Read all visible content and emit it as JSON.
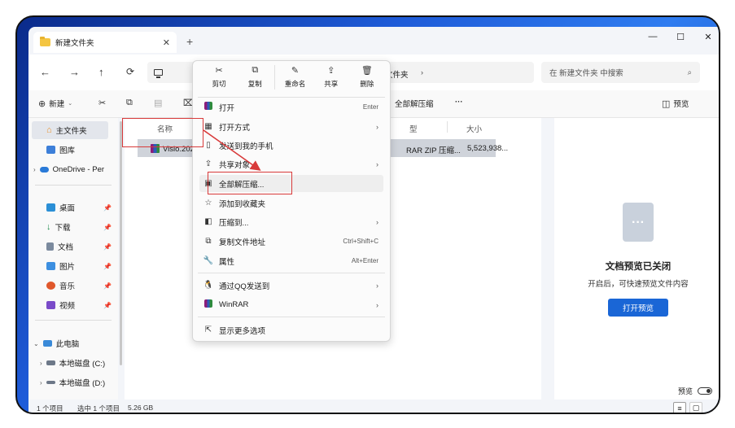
{
  "tab": {
    "title": "新建文件夹",
    "close": "✕",
    "new_tab": "+"
  },
  "window_controls": {
    "minimize": "—",
    "maximize": "☐",
    "close": "✕"
  },
  "nav": {
    "back": "←",
    "forward": "→",
    "up": "↑",
    "refresh": "⟳"
  },
  "address": {
    "current_folder": "文件夹",
    "chevron": "›"
  },
  "search": {
    "placeholder": "在 新建文件夹 中搜索",
    "icon": "⌕"
  },
  "toolbar": {
    "new_label": "新建",
    "extract_all_label": "全部解压缩",
    "more": "···",
    "preview_label": "预览"
  },
  "sidebar": {
    "home": "主文件夹",
    "gallery": "图库",
    "onedrive": "OneDrive - Per",
    "desktop": "桌面",
    "downloads": "下载",
    "documents": "文档",
    "pictures": "图片",
    "music": "音乐",
    "videos": "视频",
    "this_pc": "此电脑",
    "disk_c": "本地磁盘 (C:)",
    "disk_d": "本地磁盘 (D:)"
  },
  "columns": {
    "name": "名称",
    "type": "型",
    "size": "大小"
  },
  "file": {
    "name": "Visio.2024.zip",
    "type": "RAR ZIP 压缩...",
    "size": "5,523,938..."
  },
  "preview": {
    "title": "文档预览已关闭",
    "description": "开启后，可快速预览文件内容",
    "button": "打开预览",
    "toggle_label": "预览"
  },
  "status": {
    "count": "1 个项目",
    "selected": "选中 1 个项目",
    "size": "5.26 GB"
  },
  "context_menu": {
    "actions": [
      {
        "icon": "✂",
        "label": "剪切"
      },
      {
        "icon": "⧉",
        "label": "复制"
      },
      {
        "icon": "✎",
        "label": "重命名"
      },
      {
        "icon": "⇪",
        "label": "共享"
      },
      {
        "icon": "🗑",
        "label": "删除"
      }
    ],
    "items": {
      "open": {
        "label": "打开",
        "shortcut": "Enter"
      },
      "open_with": {
        "label": "打开方式",
        "arrow": "›"
      },
      "send_phone": {
        "label": "发送到我的手机"
      },
      "share": {
        "label": "共享对象",
        "arrow": "›"
      },
      "extract_all": {
        "label": "全部解压缩..."
      },
      "favorites": {
        "label": "添加到收藏夹"
      },
      "compress": {
        "label": "压缩到...",
        "arrow": "›"
      },
      "copy_path": {
        "label": "复制文件地址",
        "shortcut": "Ctrl+Shift+C"
      },
      "properties": {
        "label": "属性",
        "shortcut": "Alt+Enter"
      },
      "send_qq": {
        "label": "通过QQ发送到",
        "arrow": "›"
      },
      "winrar": {
        "label": "WinRAR",
        "arrow": "›"
      },
      "more_options": {
        "label": "显示更多选项"
      }
    }
  },
  "colors": {
    "accent": "#1a66d6",
    "highlight": "#d83a3a",
    "selection": "#cfd3da"
  }
}
